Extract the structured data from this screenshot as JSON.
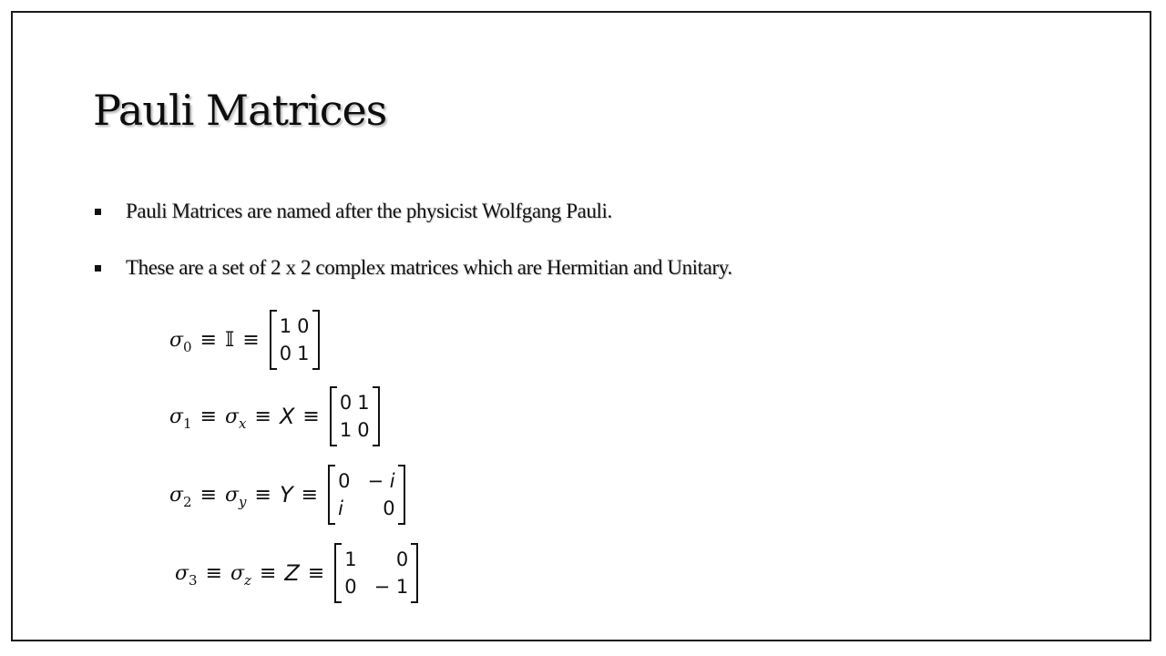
{
  "slide": {
    "title": "Pauli Matrices",
    "bullets": [
      "Pauli Matrices are named after the physicist Wolfgang Pauli.",
      "These are a set of 2 x 2 complex matrices which are Hermitian and Unitary."
    ]
  },
  "equations": [
    {
      "sigma": "σ",
      "index": "0",
      "rel": "≡",
      "alias_symbol": "𝕀",
      "matrix": [
        [
          "1",
          "0"
        ],
        [
          "0",
          "1"
        ]
      ]
    },
    {
      "sigma": "σ",
      "index": "1",
      "rel": "≡",
      "axis": "x",
      "letter": "X",
      "matrix": [
        [
          "0",
          "1"
        ],
        [
          "1",
          "0"
        ]
      ]
    },
    {
      "sigma": "σ",
      "index": "2",
      "rel": "≡",
      "axis": "y",
      "letter": "Y",
      "matrix": [
        [
          "0",
          "− i"
        ],
        [
          "i",
          "0"
        ]
      ]
    },
    {
      "sigma": "σ",
      "index": "3",
      "rel": "≡",
      "axis": "z",
      "letter": "Z",
      "matrix": [
        [
          "1",
          "0"
        ],
        [
          "0",
          "− 1"
        ]
      ]
    }
  ]
}
